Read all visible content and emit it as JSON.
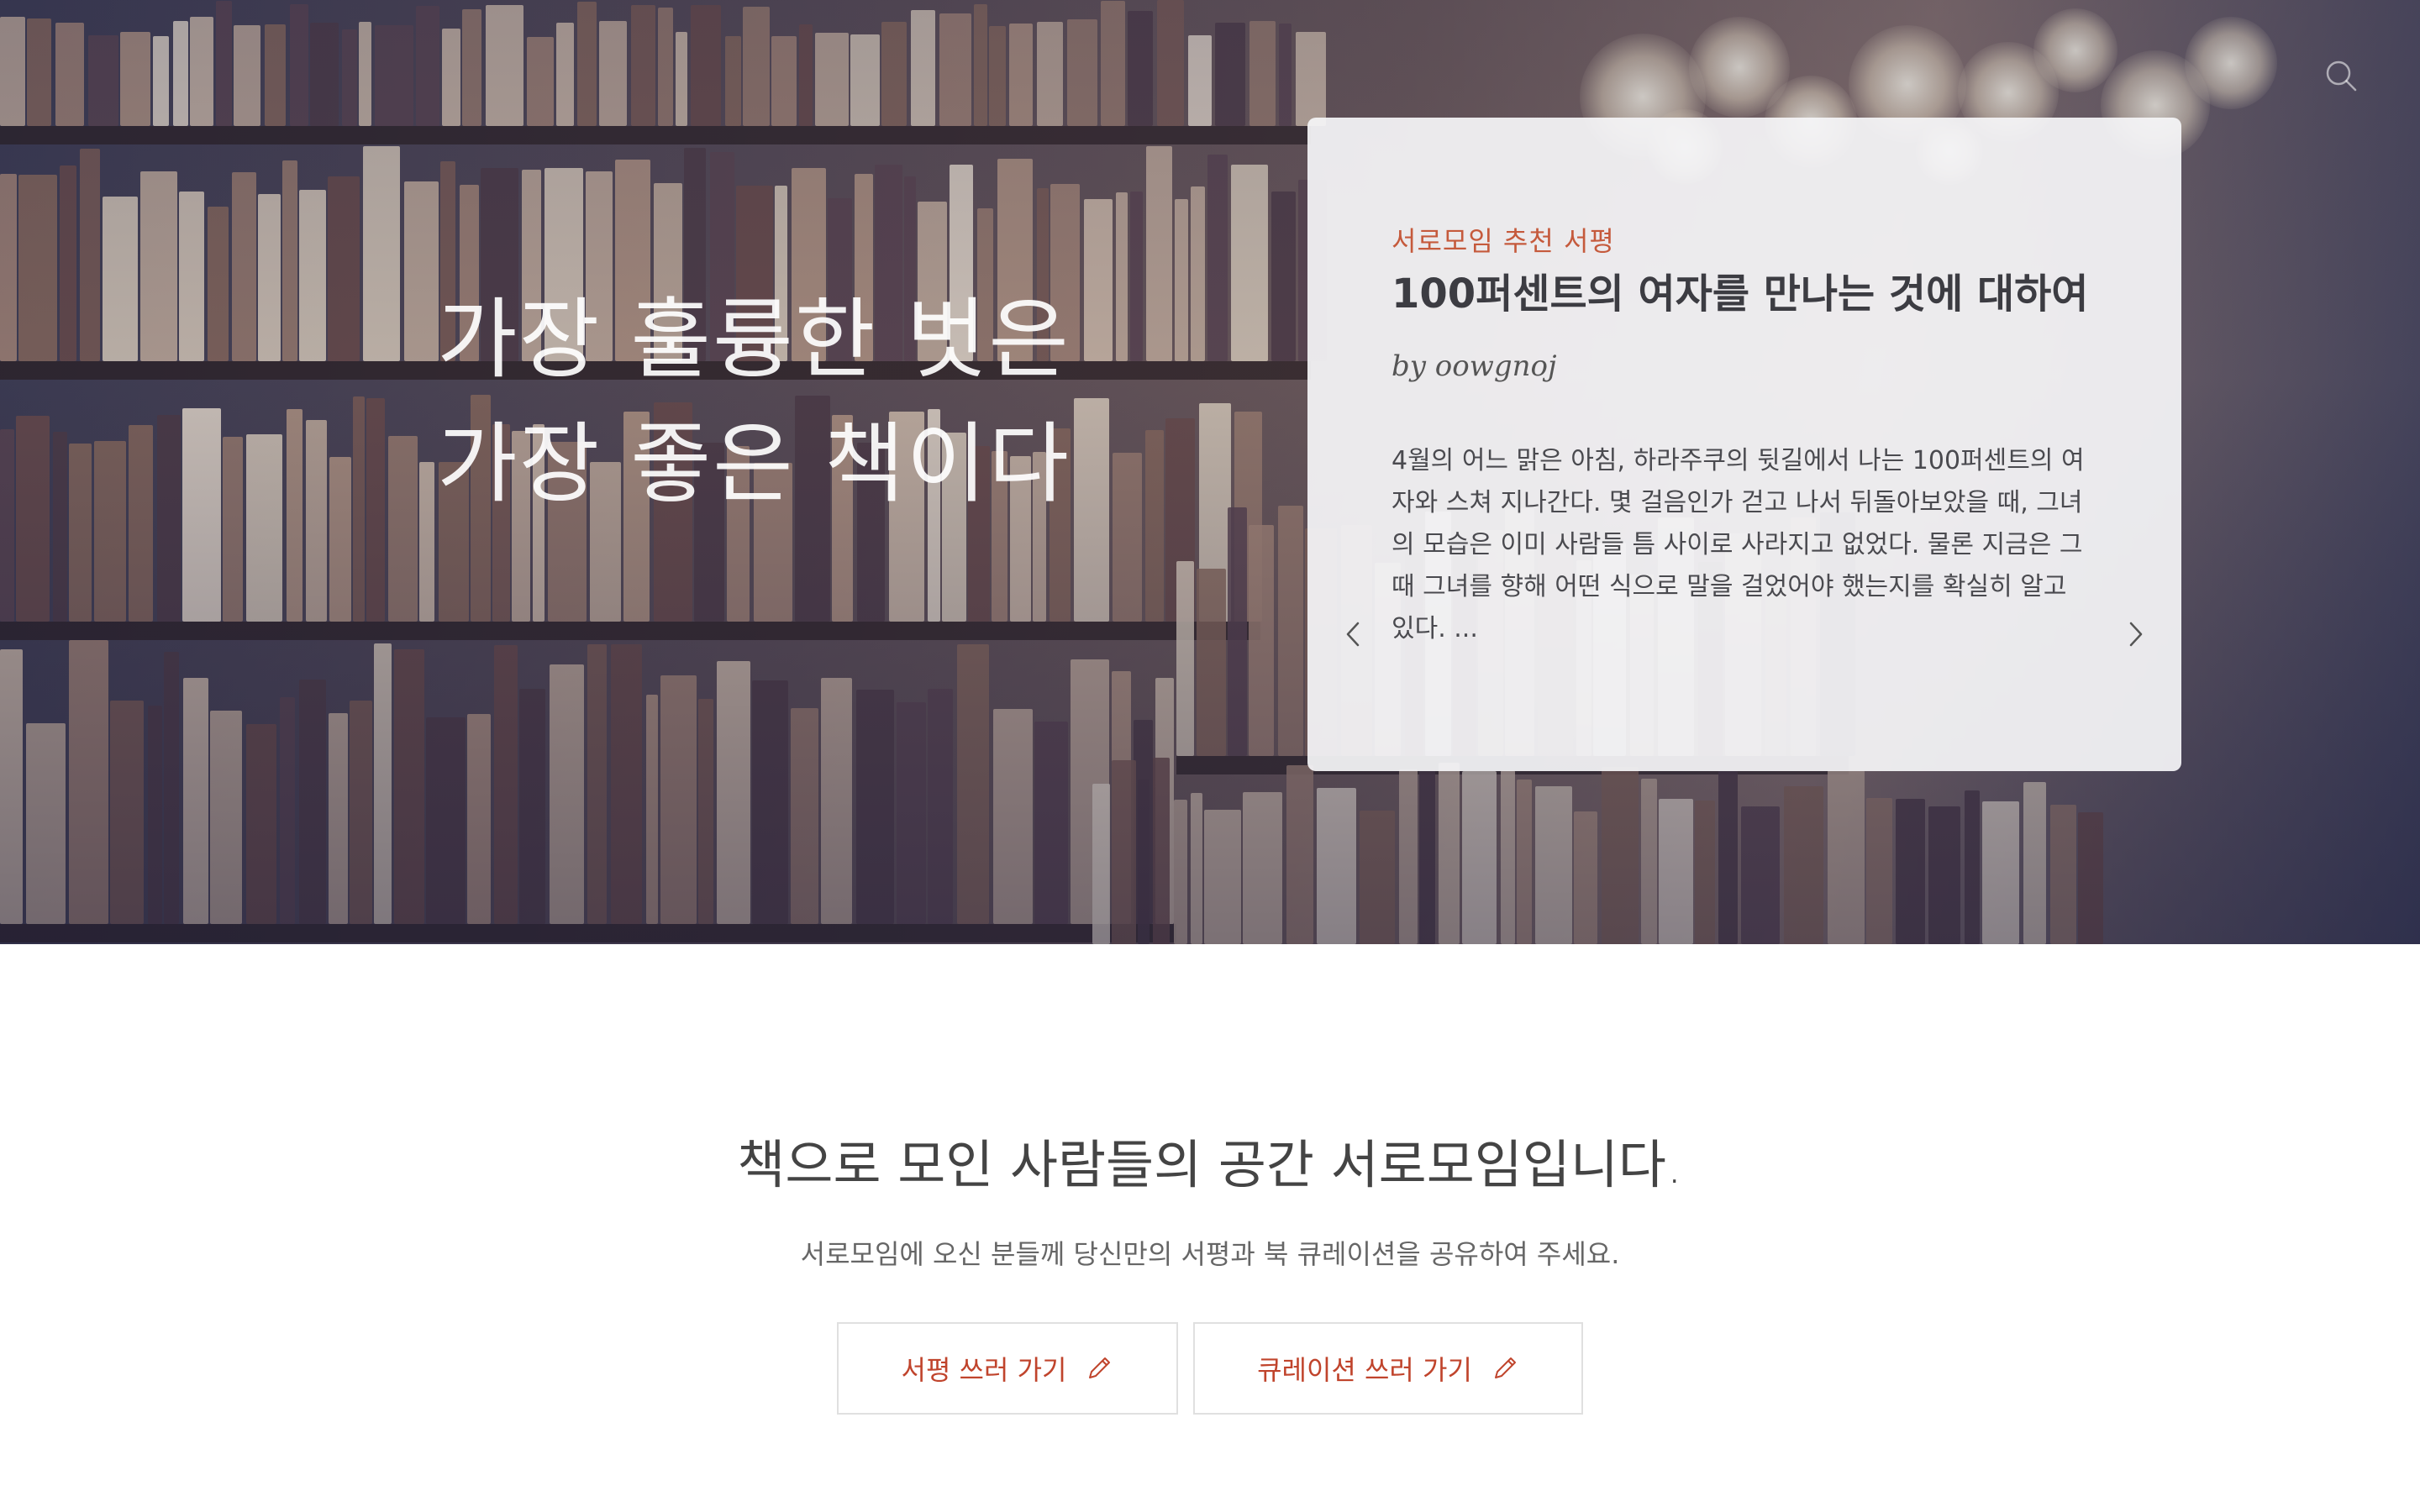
{
  "hero": {
    "quote_line1": "가장 훌륭한 벗은",
    "quote_line2": "가장 좋은 책이다"
  },
  "review_card": {
    "category": "서로모임 추천 서평",
    "title": "100퍼센트의 여자를 만나는 것에 대하여",
    "author": "by oowgnoj",
    "excerpt": "4월의 어느 맑은 아침, 하라주쿠의 뒷길에서 나는 100퍼센트의 여자와 스쳐 지나간다. 몇 걸음인가 걷고 나서 뒤돌아보았을 때, 그녀의 모습은 이미 사람들 틈 사이로 사라지고 없었다. 물론 지금은 그때 그녀를 향해 어떤 식으로 말을 걸었어야 했는지를 확실히 알고 있다. ..."
  },
  "welcome": {
    "title": "책으로 모인 사람들의 공간 서로모임입니다.",
    "subtitle": "서로모임에 오신 분들께 당신만의 서평과 북 큐레이션을 공유하여 주세요.",
    "write_review_label": "서평 쓰러 가기",
    "write_curation_label": "큐레이션 쓰러 가기"
  },
  "icons": {
    "search": "search-icon",
    "prev": "chevron-left-icon",
    "next": "chevron-right-icon",
    "pencil": "pencil-icon"
  },
  "colors": {
    "accent": "#c0442c",
    "category": "#c55a3c",
    "card_bg": "#f4f4f7"
  }
}
